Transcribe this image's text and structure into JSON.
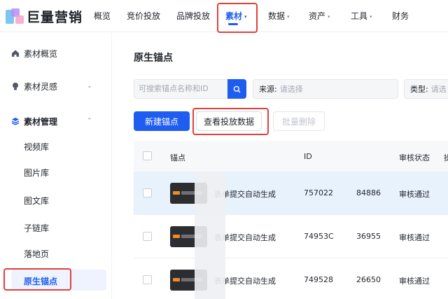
{
  "brand": {
    "name": "巨量营销"
  },
  "nav": {
    "items": [
      {
        "label": "概览",
        "has_caret": false
      },
      {
        "label": "竞价投放",
        "has_caret": false
      },
      {
        "label": "品牌投放",
        "has_caret": false
      },
      {
        "label": "素材",
        "has_caret": true,
        "active": true
      },
      {
        "label": "数据",
        "has_caret": true
      },
      {
        "label": "资产",
        "has_caret": true
      },
      {
        "label": "工具",
        "has_caret": true
      },
      {
        "label": "财务",
        "has_caret": false
      }
    ],
    "caret": "▾"
  },
  "sidebar": {
    "groups": [
      {
        "label": "素材概览",
        "icon": "home-icon"
      },
      {
        "label": "素材灵感",
        "icon": "bulb-icon",
        "chevron": "⌄"
      },
      {
        "label": "素材管理",
        "icon": "layers-icon",
        "chevron": "⌃",
        "expanded": true
      }
    ],
    "sub_items": [
      "视频库",
      "图片库",
      "图文库",
      "子链库",
      "落地页",
      "原生锚点"
    ],
    "selected": "原生锚点"
  },
  "main": {
    "title": "原生锚点",
    "search": {
      "placeholder": "可搜索锚点名称和ID"
    },
    "filters": [
      {
        "label": "来源:",
        "placeholder": "请选择"
      },
      {
        "label": "类型:",
        "placeholder": "请选"
      }
    ],
    "buttons": {
      "create": "新建锚点",
      "view_data": "查看投放数据",
      "batch_delete": "批量删除"
    },
    "table": {
      "headers": [
        "锚点",
        "ID",
        "审核状态",
        "操"
      ],
      "rows": [
        {
          "name": "表单提交自动生成",
          "id_start": "757022",
          "id_end": "84886",
          "status": "审核通过"
        },
        {
          "name": "表单提交自动生成",
          "id_start": "74953C",
          "id_end": "36955",
          "status": "审核通过"
        },
        {
          "name": "表单提交自动生成",
          "id_start": "749528",
          "id_end": "26650",
          "status": "审核通过"
        }
      ]
    }
  },
  "colors": {
    "accent": "#1f5cf0",
    "highlight_box": "#e0413a",
    "row_hover": "#e8f2fd"
  }
}
